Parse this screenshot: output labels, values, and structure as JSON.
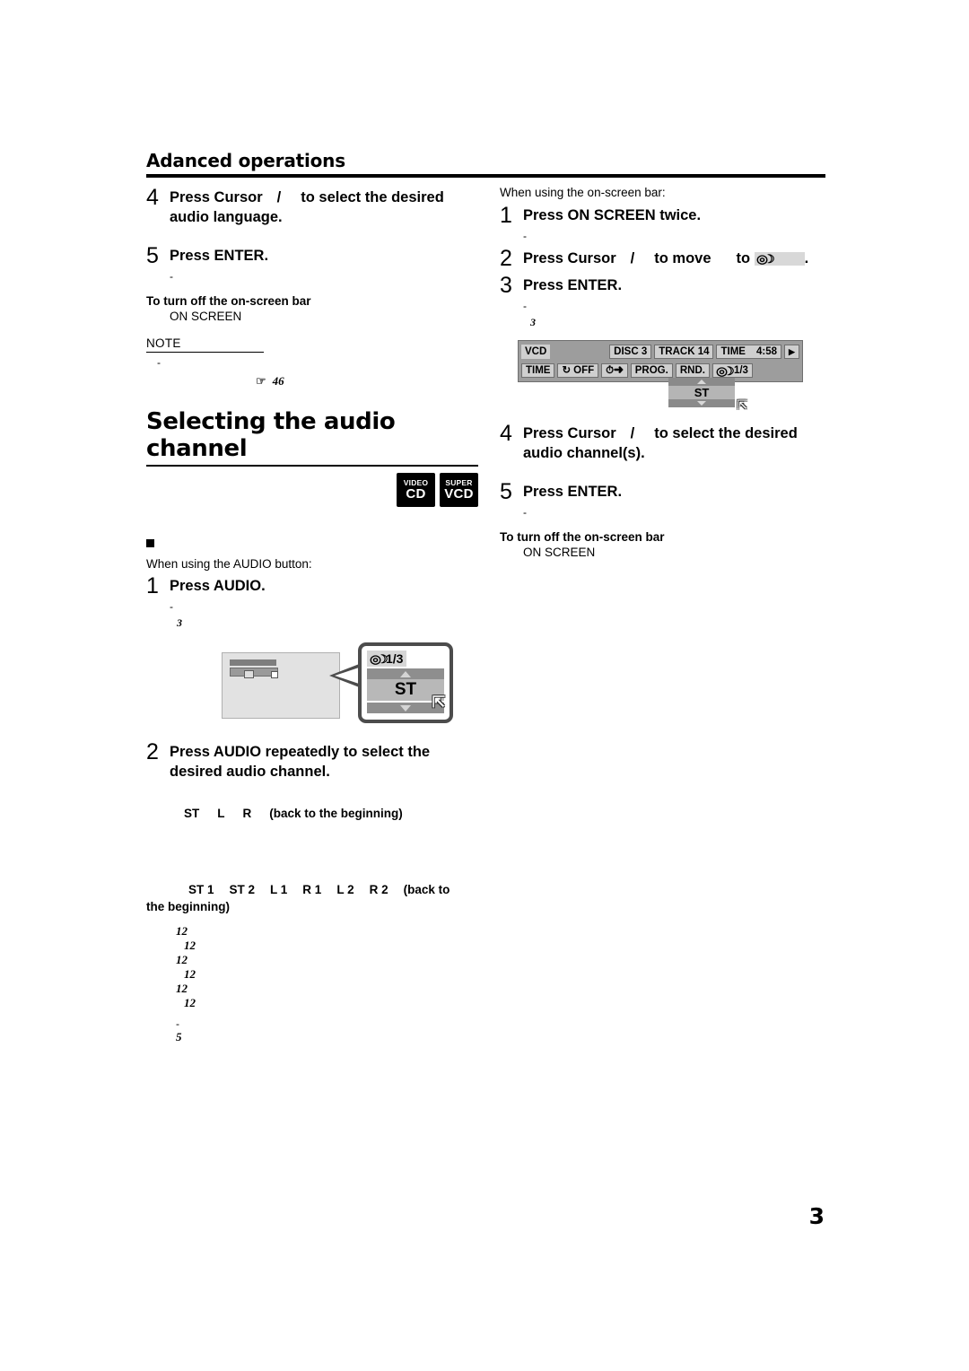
{
  "running_head": {
    "text": "Adanced operations"
  },
  "left_column": {
    "step4": {
      "num": "4",
      "part1": "Press Cursor",
      "slash": "/",
      "part2": "to select the desired",
      "line2": "audio language."
    },
    "step5": {
      "num": "5",
      "text": "Press ENTER.",
      "dash": "-"
    },
    "turn_off_heading": "To turn off the on-screen bar",
    "turn_off_body": "ON SCREEN",
    "note": {
      "label": "NOTE",
      "dash": "-",
      "ref_icon": "pointing-hand-icon",
      "ref_page": "46"
    },
    "section_title": "Selecting the audio channel",
    "badges": [
      {
        "top": "VIDEO",
        "bottom": "CD"
      },
      {
        "top": "SUPER",
        "bottom": "VCD"
      }
    ],
    "lead_in": "When using the AUDIO button:",
    "step1": {
      "num": "1",
      "text": "Press AUDIO.",
      "dash": "-",
      "tiny": "3"
    },
    "tv_figure": {
      "osd_label": "1/3",
      "osd_icon": "dolby-audio-icon",
      "osd_value": "ST",
      "up_arrow": "triangle-up-icon",
      "down_arrow": "triangle-down-icon",
      "cursor": "mouse-pointer-icon"
    },
    "step2": {
      "num": "2",
      "line1": "Press AUDIO repeatedly to select the",
      "line2": "desired audio channel."
    },
    "sequence_vcd": {
      "items": [
        "ST",
        "L",
        "R"
      ],
      "note": "(back to the beginning)"
    },
    "sequence_svcd": {
      "items": [
        "ST 1",
        "ST 2",
        "L 1",
        "R 1",
        "L 2",
        "R 2"
      ],
      "note_line1": "(back to",
      "note_line2": "the beginning)"
    },
    "italic_numbers": [
      "12",
      "12",
      "12",
      "12",
      "12",
      "12"
    ],
    "tail_dash": "-",
    "tail_num": "5"
  },
  "right_column": {
    "lead_in": "When using the on-screen bar:",
    "step1": {
      "num": "1",
      "text": "Press ON SCREEN twice.",
      "dash": "-"
    },
    "step2": {
      "num": "2",
      "part1": "Press Cursor",
      "slash": "/",
      "part2": "to move",
      "part3": "to",
      "chip_icon": "dolby-audio-icon",
      "period": "."
    },
    "step3": {
      "num": "3",
      "text": "Press ENTER.",
      "dash": "-",
      "tiny": "3"
    },
    "on_screen_bar": {
      "row1": {
        "source": "VCD",
        "disc": "DISC 3",
        "track": "TRACK 14",
        "time_label": "TIME",
        "time_value": "4:58",
        "play_icon": "play-triangle-icon"
      },
      "row2": {
        "time": "TIME",
        "repeat_icon": "repeat-icon",
        "repeat_value": "OFF",
        "clock_icon": "clock-arrow-icon",
        "prog": "PROG.",
        "rnd": "RND.",
        "audio_icon": "dolby-audio-icon",
        "audio_value": "1/3"
      },
      "dropdown": {
        "up_arrow": "triangle-up-icon",
        "value": "ST",
        "down_arrow": "triangle-down-icon",
        "cursor": "mouse-pointer-icon"
      }
    },
    "step4": {
      "num": "4",
      "part1": "Press Cursor",
      "slash": "/",
      "part2": "to select the desired",
      "line2": "audio channel(s)."
    },
    "step5": {
      "num": "5",
      "text": "Press ENTER.",
      "dash": "-"
    },
    "turn_off_heading": "To turn off the on-screen bar",
    "turn_off_body": "ON SCREEN"
  },
  "footer": {
    "page_number": "3"
  }
}
